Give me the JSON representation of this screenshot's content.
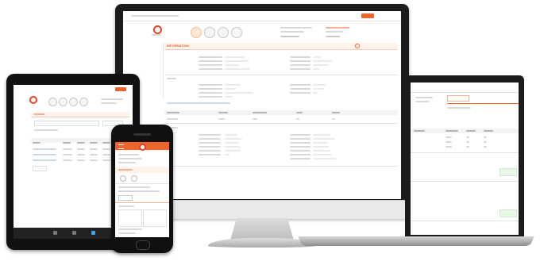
{
  "monitor_screen": {
    "section_title": "INFORMATION"
  },
  "tablet_screen": {
    "section_title": "DEVICES"
  },
  "colors": {
    "accent": "#f0632b",
    "device_frame": "#1b1b1b",
    "device_silver": "#d6d6d6"
  },
  "icons": [
    "logo-icon",
    "info-icon",
    "gear-icon",
    "tools-icon",
    "camera-icon",
    "close-icon",
    "home-icon"
  ]
}
